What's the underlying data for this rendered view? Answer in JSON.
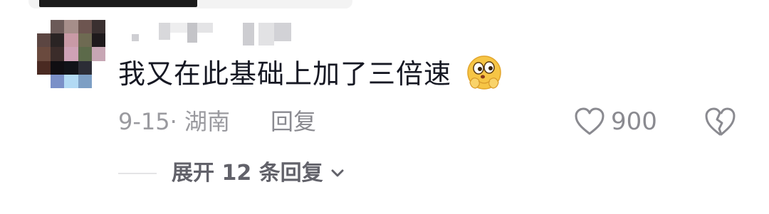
{
  "comment": {
    "text": "我又在此基础上加了三倍速",
    "emoji_icon": "thinking-hands-emoji-icon",
    "date_location": "9-15· 湖南",
    "reply_label": "回复",
    "like_count": "900",
    "expand_label": "展开 12 条回复"
  },
  "colors": {
    "text_primary": "#161823",
    "text_secondary": "#9a9a9f",
    "expand_text": "#62626a"
  },
  "icons": {
    "like": "heart-outline-icon",
    "dislike": "broken-heart-icon",
    "expand": "chevron-down-icon"
  }
}
